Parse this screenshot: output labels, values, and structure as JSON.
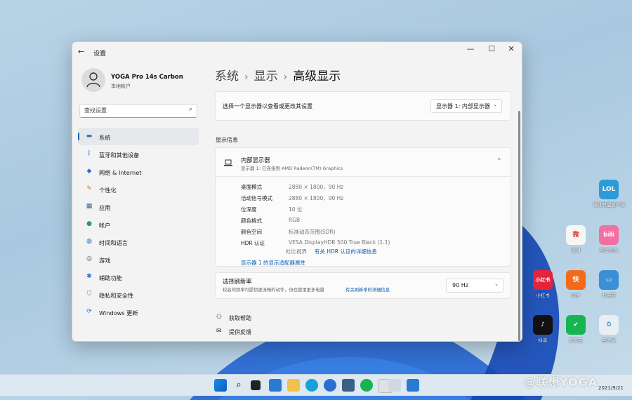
{
  "window": {
    "title": "设置",
    "minimize": "—",
    "maximize": "☐",
    "close": "✕",
    "back": "←"
  },
  "profile": {
    "name": "YOGA Pro 14s Carbon",
    "account": "本地帐户"
  },
  "search": {
    "placeholder": "查找设置"
  },
  "nav": [
    {
      "label": "系统",
      "icon": "monitor-icon",
      "color": "#2a7ad1"
    },
    {
      "label": "蓝牙和其他设备",
      "icon": "bluetooth-icon",
      "color": "#1f6fd1"
    },
    {
      "label": "网络 & Internet",
      "icon": "wifi-icon",
      "color": "#1f6fd1"
    },
    {
      "label": "个性化",
      "icon": "brush-icon",
      "color": "#c27b1b"
    },
    {
      "label": "应用",
      "icon": "apps-icon",
      "color": "#3b5f86"
    },
    {
      "label": "帐户",
      "icon": "account-icon",
      "color": "#1aa35f"
    },
    {
      "label": "时间和语言",
      "icon": "globe-icon",
      "color": "#1f6fd1"
    },
    {
      "label": "游戏",
      "icon": "gamepad-icon",
      "color": "#555555"
    },
    {
      "label": "辅助功能",
      "icon": "accessibility-icon",
      "color": "#1f6fd1"
    },
    {
      "label": "隐私和安全性",
      "icon": "shield-icon",
      "color": "#777777"
    },
    {
      "label": "Windows 更新",
      "icon": "update-icon",
      "color": "#1f6fd1"
    }
  ],
  "breadcrumb": {
    "part1": "系统",
    "part2": "显示",
    "current": "高级显示"
  },
  "select_display": {
    "label": "选择一个显示器以查看或更改其设置",
    "value": "显示器 1: 内部显示器"
  },
  "section_title": "显示信息",
  "display": {
    "name": "内部显示器",
    "sub": "显示器 1: 已连接到 AMD Radeon(TM) Graphics",
    "rows": [
      {
        "key": "桌面模式",
        "value": "2880 × 1800，90 Hz"
      },
      {
        "key": "活动信号模式",
        "value": "2880 × 1800，90 Hz"
      },
      {
        "key": "位深度",
        "value": "10 位"
      },
      {
        "key": "颜色格式",
        "value": "RGB"
      },
      {
        "key": "颜色空间",
        "value": "标准动态范围(SDR)"
      },
      {
        "key": "HDR 认证",
        "value": "VESA DisplayHDR 500 True Black (1.1)"
      }
    ],
    "hdr_link_prefix": " 杜比视界 ",
    "hdr_link": "有关 HDR 认证的详细信息",
    "adapter_link": "显示器 1 的显示适配器属性"
  },
  "refresh": {
    "title": "选择刷新率",
    "desc": "较高的频率可提供更流畅的动作，但也使用更多电量",
    "desc_link": "有关刷新率的详细信息",
    "value": "90 Hz"
  },
  "help": {
    "get_help": "获取帮助",
    "feedback": "提供反馈"
  },
  "desktop_icons": [
    {
      "label": "英雄联盟客户端",
      "color": "#2d9bd7",
      "glyph": "LOL"
    },
    {
      "label": "微博",
      "color": "#f6f6f6",
      "glyph": "微"
    },
    {
      "label": "哔哩哔哩",
      "color": "#f36fa3",
      "glyph": "bili"
    },
    {
      "label": "小红书",
      "color": "#e6233c",
      "glyph": "小红书"
    },
    {
      "label": "快手",
      "color": "#f26a1b",
      "glyph": "快"
    },
    {
      "label": "此电脑",
      "color": "#3a8fd6",
      "glyph": "▭"
    },
    {
      "label": "抖音",
      "color": "#111111",
      "glyph": "♪"
    },
    {
      "label": "爱奇艺",
      "color": "#17b452",
      "glyph": "✔"
    },
    {
      "label": "回收站",
      "color": "#e9eef2",
      "glyph": "♻"
    }
  ],
  "watermark": {
    "text": "@联想YOGA",
    "date": "2021/9/21"
  }
}
